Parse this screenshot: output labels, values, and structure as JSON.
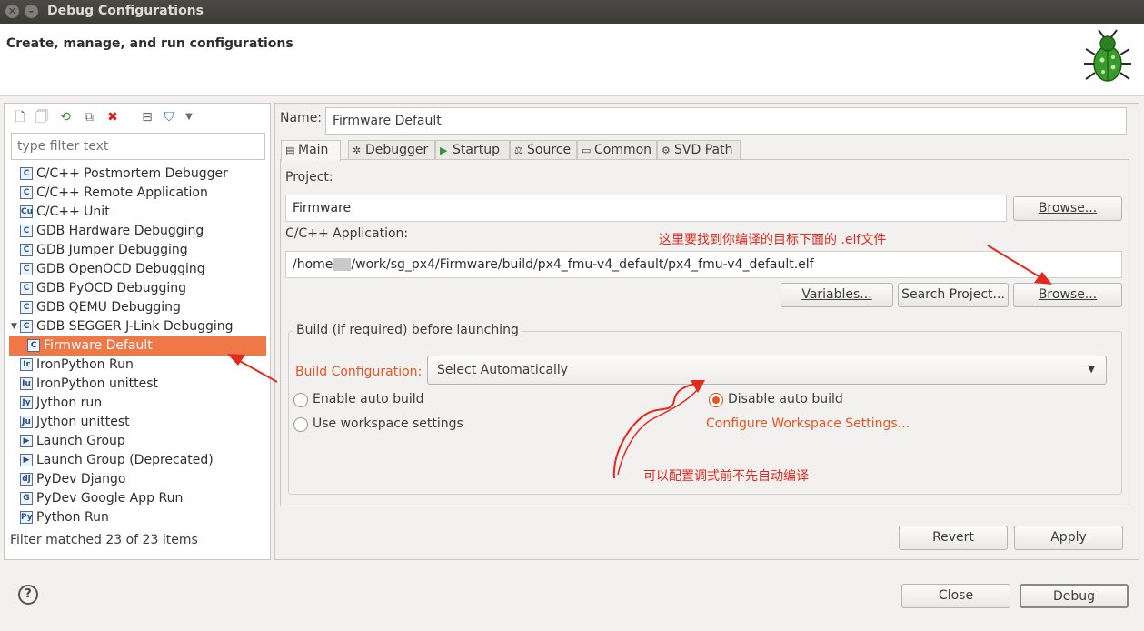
{
  "window": {
    "title": "Debug Configurations",
    "header_subtitle": "Create, manage, and run configurations"
  },
  "left": {
    "filter_placeholder": "type filter text",
    "toolbar_icons": [
      "new-config-icon",
      "new-prototype-icon",
      "export-icon",
      "duplicate-icon",
      "delete-icon",
      "collapse-all-icon",
      "filter-icon",
      "view-menu-icon"
    ],
    "tree": [
      {
        "label": "C/C++ Postmortem Debugger",
        "icon": "c-config-icon"
      },
      {
        "label": "C/C++ Remote Application",
        "icon": "c-config-icon"
      },
      {
        "label": "C/C++ Unit",
        "icon": "c-unit-icon"
      },
      {
        "label": "GDB Hardware Debugging",
        "icon": "c-config-icon"
      },
      {
        "label": "GDB Jumper Debugging",
        "icon": "c-config-icon"
      },
      {
        "label": "GDB OpenOCD Debugging",
        "icon": "c-config-icon"
      },
      {
        "label": "GDB PyOCD Debugging",
        "icon": "c-config-icon"
      },
      {
        "label": "GDB QEMU Debugging",
        "icon": "c-config-icon"
      },
      {
        "label": "GDB SEGGER J-Link Debugging",
        "icon": "c-config-icon",
        "expanded": true
      },
      {
        "label": "Firmware Default",
        "icon": "c-config-icon",
        "child": true,
        "selected": true
      },
      {
        "label": "IronPython Run",
        "icon": "ironpython-icon"
      },
      {
        "label": "IronPython unittest",
        "icon": "ironpython-unittest-icon"
      },
      {
        "label": "Jython run",
        "icon": "jython-icon"
      },
      {
        "label": "Jython unittest",
        "icon": "jython-unittest-icon"
      },
      {
        "label": "Launch Group",
        "icon": "launch-group-icon"
      },
      {
        "label": "Launch Group (Deprecated)",
        "icon": "launch-group-deprecated-icon"
      },
      {
        "label": "PyDev Django",
        "icon": "django-icon"
      },
      {
        "label": "PyDev Google App Run",
        "icon": "google-app-icon"
      },
      {
        "label": "Python Run",
        "icon": "python-icon"
      }
    ],
    "filter_status": "Filter matched 23 of 23 items"
  },
  "right": {
    "name_label": "Name:",
    "name_value": "Firmware Default",
    "tabs": [
      {
        "label": "Main",
        "icon": "main-tab-icon"
      },
      {
        "label": "Debugger",
        "icon": "debugger-bug-icon"
      },
      {
        "label": "Startup",
        "icon": "startup-play-icon"
      },
      {
        "label": "Source",
        "icon": "source-icon"
      },
      {
        "label": "Common",
        "icon": "common-icon"
      },
      {
        "label": "SVD Path",
        "icon": "svd-icon"
      }
    ],
    "project_label": "Project:",
    "project_value": "Firmware",
    "browse_label": "Browse...",
    "app_label": "C/C++ Application:",
    "app_value_prefix": "/home",
    "app_value_suffix": "/work/sg_px4/Firmware/build/px4_fmu-v4_default/px4_fmu-v4_default.elf",
    "variables_label": "Variables...",
    "search_project_label": "Search Project...",
    "browse2_label": "Browse...",
    "build_group_title": "Build (if required) before launching",
    "build_config_label": "Build Configuration:",
    "build_config_value": "Select Automatically",
    "radio_enable": "Enable auto build",
    "radio_disable": "Disable auto build",
    "radio_workspace": "Use workspace settings",
    "configure_link": "Configure Workspace Settings...",
    "revert_label": "Revert",
    "apply_label": "Apply"
  },
  "annotations": {
    "elf_note": "这里要找到你编译的目标下面的 .elf文件",
    "build_note": "可以配置调式前不先自动编译"
  },
  "footer": {
    "close_label": "Close",
    "debug_label": "Debug"
  },
  "colors": {
    "selection": "#f07746",
    "accent": "#e95420",
    "annotation": "#e32a1f"
  }
}
